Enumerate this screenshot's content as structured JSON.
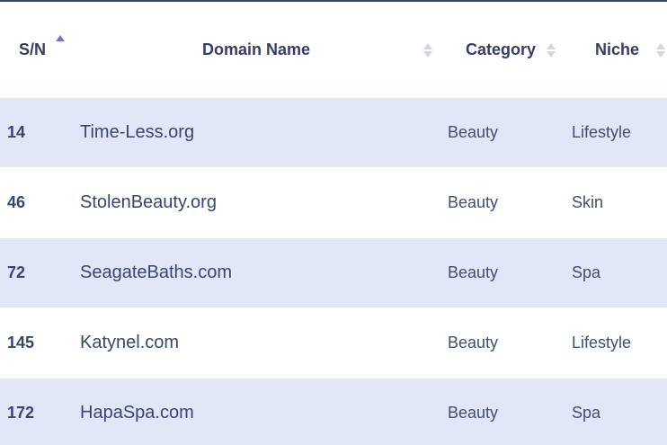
{
  "table": {
    "headers": {
      "sn": "S/N",
      "domain": "Domain Name",
      "category": "Category",
      "niche": "Niche"
    },
    "sort": {
      "column": "sn",
      "direction": "ascending"
    },
    "rows": [
      {
        "sn": "14",
        "domain": "Time-Less.org",
        "category": "Beauty",
        "niche": "Lifestyle"
      },
      {
        "sn": "46",
        "domain": "StolenBeauty.org",
        "category": "Beauty",
        "niche": "Skin"
      },
      {
        "sn": "72",
        "domain": "SeagateBaths.com",
        "category": "Beauty",
        "niche": "Spa"
      },
      {
        "sn": "145",
        "domain": "Katynel.com",
        "category": "Beauty",
        "niche": "Lifestyle"
      },
      {
        "sn": "172",
        "domain": "HapaSpa.com",
        "category": "Beauty",
        "niche": "Spa"
      }
    ]
  },
  "colors": {
    "header_text": "#343e66",
    "row_stripe": "#e2e7f8",
    "sort_active": "#6a76c9",
    "sort_inactive": "#d4d7e0",
    "top_rule": "#3a4566"
  }
}
